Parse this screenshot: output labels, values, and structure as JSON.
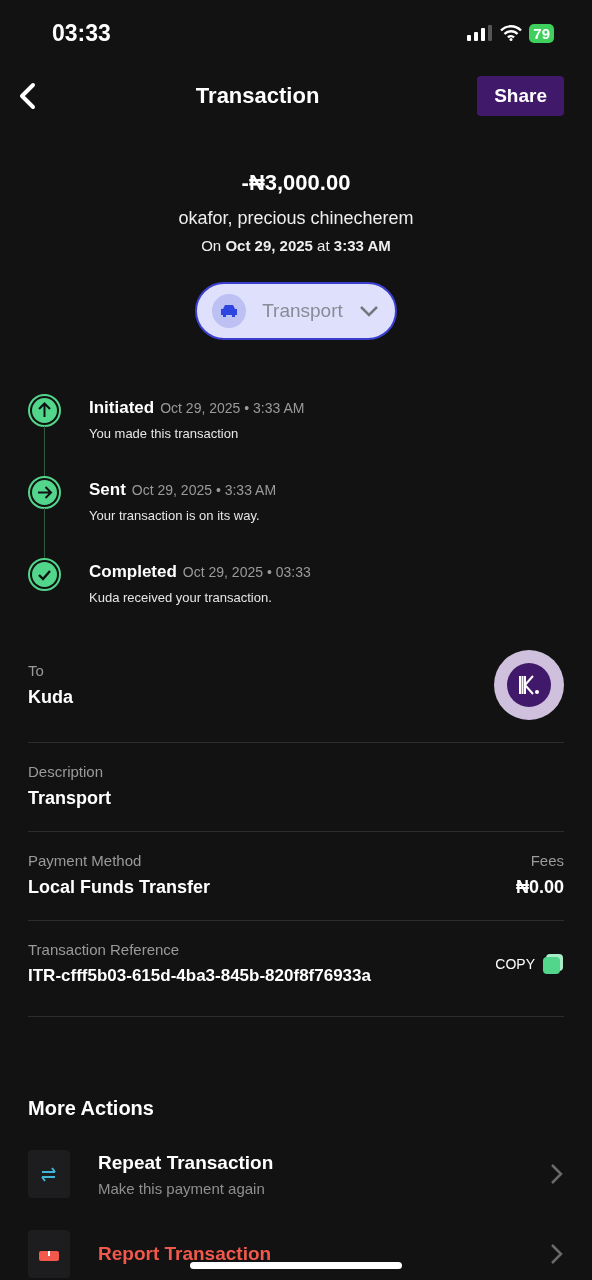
{
  "status_bar": {
    "time": "03:33",
    "battery": "79"
  },
  "header": {
    "title": "Transaction",
    "share_button": "Share"
  },
  "summary": {
    "amount": "-₦3,000.00",
    "name": "okafor, precious chinecherem",
    "date_line": "On **Oct 29, 2025** at **3:33 AM**"
  },
  "category": {
    "label": "Transport"
  },
  "timeline": [
    {
      "kind": "initiated",
      "title": "Initiated",
      "time": "Oct 29, 2025 • 3:33 AM",
      "note": "You made this transaction"
    },
    {
      "kind": "sent",
      "title": "Sent",
      "time": "Oct 29, 2025 • 3:33 AM",
      "note": "Your transaction is on its way."
    },
    {
      "kind": "completed",
      "title": "Completed",
      "time": "Oct 29, 2025 • 03:33",
      "note": "Kuda received your transaction."
    }
  ],
  "details": {
    "to": {
      "label": "To",
      "value": "Kuda"
    },
    "description": {
      "label": "Description",
      "value": "Transport"
    },
    "payment_method": {
      "label": "Payment Method",
      "value": "Local Funds Transfer"
    },
    "fees": {
      "label": "Fees",
      "value": "₦0.00"
    },
    "reference": {
      "label": "Transaction Reference",
      "value": "ITR-cfff5b03-615d-4ba3-845b-820f8f76933a",
      "copy_button": "COPY"
    }
  },
  "more_actions": {
    "title": "More Actions",
    "items": [
      {
        "kind": "repeat",
        "title": "Repeat Transaction",
        "subtitle": "Make this payment again"
      },
      {
        "kind": "report",
        "title": "Report Transaction"
      }
    ]
  }
}
